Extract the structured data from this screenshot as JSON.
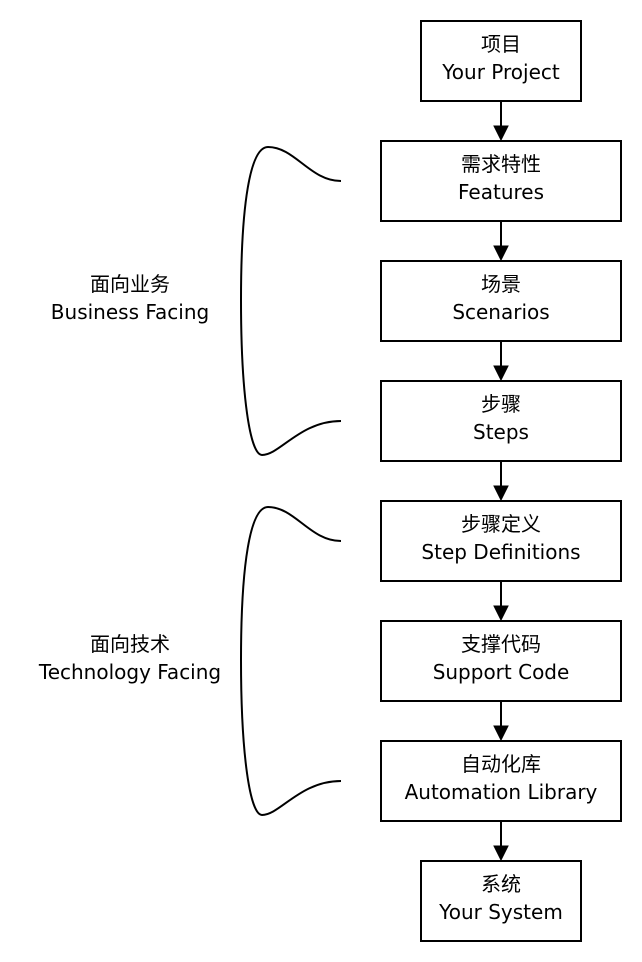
{
  "nodes": [
    {
      "zh": "项目",
      "en": "Your Project"
    },
    {
      "zh": "需求特性",
      "en": "Features"
    },
    {
      "zh": "场景",
      "en": "Scenarios"
    },
    {
      "zh": "步骤",
      "en": "Steps"
    },
    {
      "zh": "步骤定义",
      "en": "Step Definitions"
    },
    {
      "zh": "支撑代码",
      "en": "Support Code"
    },
    {
      "zh": "自动化库",
      "en": "Automation Library"
    },
    {
      "zh": "系统",
      "en": "Your System"
    }
  ],
  "groups": [
    {
      "zh": "面向业务",
      "en": "Business Facing"
    },
    {
      "zh": "面向技术",
      "en": "Technology Facing"
    }
  ]
}
